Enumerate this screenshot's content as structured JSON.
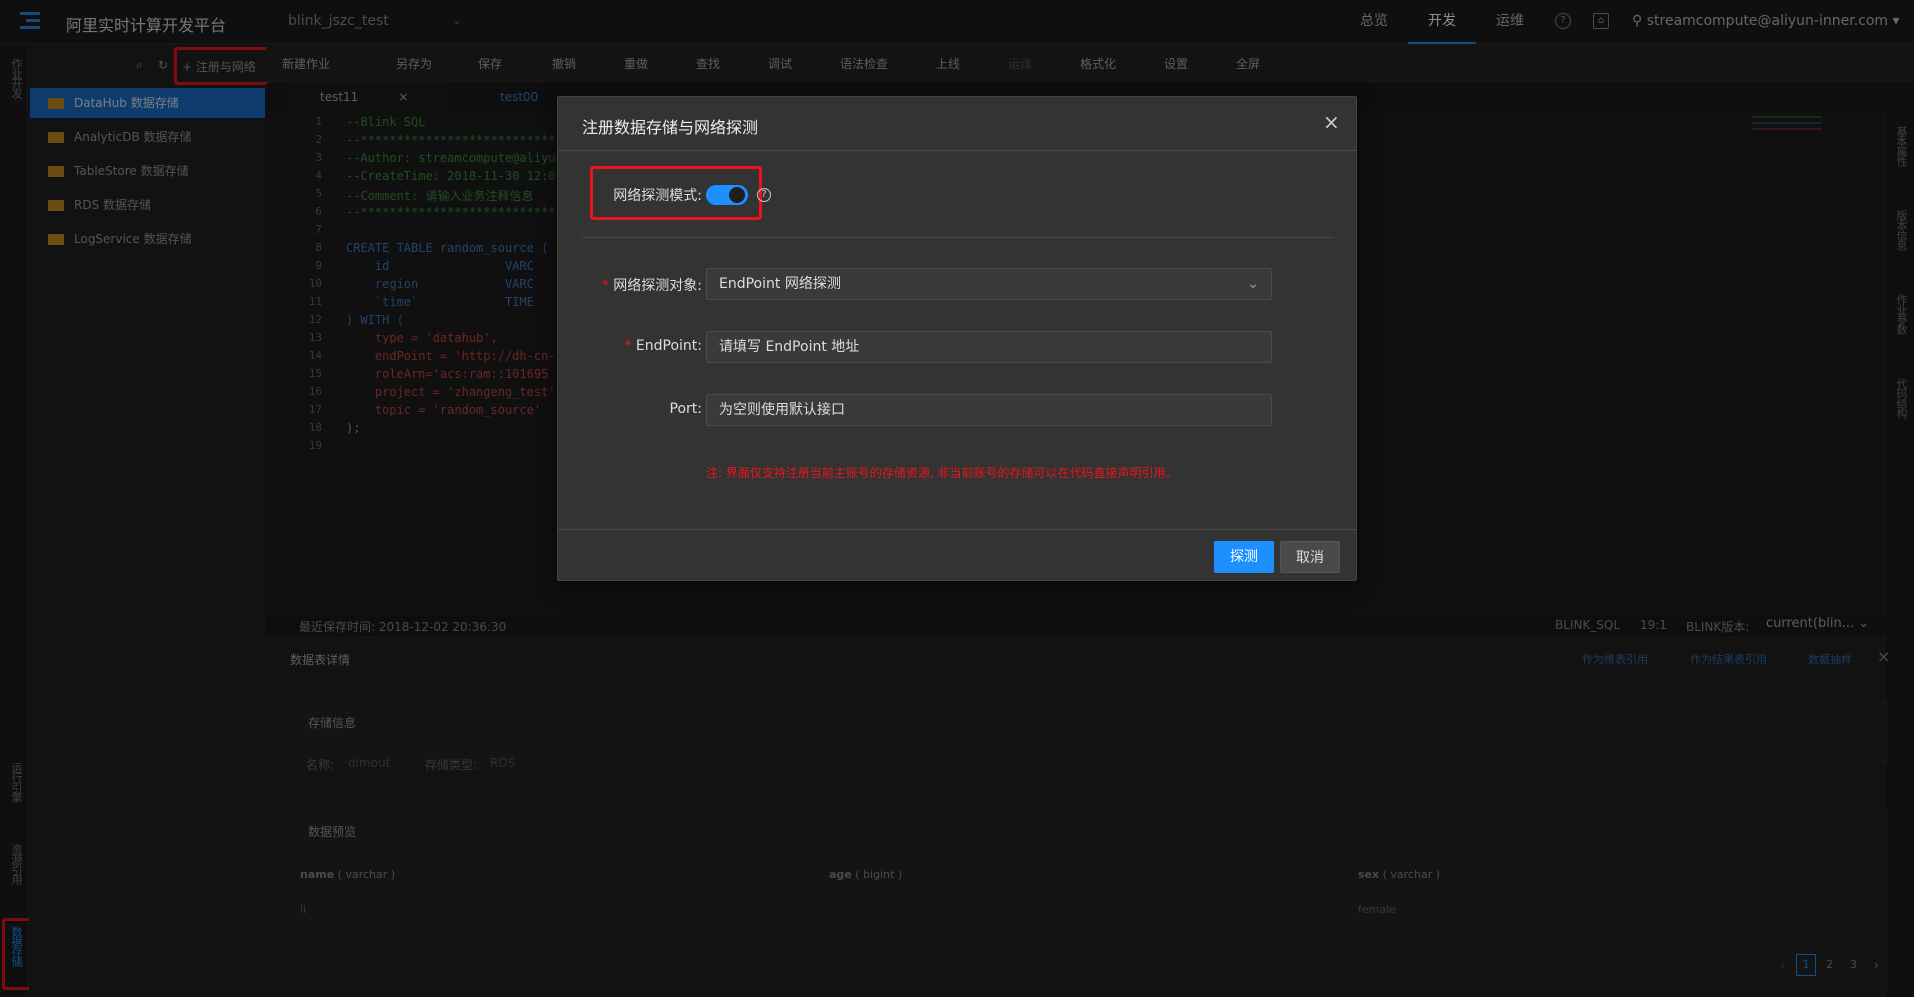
{
  "app": {
    "title": "阿里实时计算开发平台",
    "project": "blink_jszc_test"
  },
  "nav": {
    "items": [
      "总览",
      "开发",
      "运维"
    ],
    "active": "开发",
    "user": "streamcompute@aliyun-inner.com"
  },
  "left_strip": {
    "items": [
      "作业开发",
      "运行引擎",
      "资源引用",
      "数据存储"
    ]
  },
  "sidebar": {
    "register_label": "+ 注册与网络",
    "items": [
      "DataHub 数据存储",
      "AnalyticDB 数据存储",
      "TableStore 数据存储",
      "RDS 数据存储",
      "LogService 数据存储"
    ]
  },
  "toolbar": {
    "items": [
      "新建作业",
      "另存为",
      "保存",
      "撤销",
      "重做",
      "查找",
      "调试",
      "语法检查",
      "上线",
      "运维",
      "格式化",
      "设置",
      "全屏"
    ]
  },
  "tabs": [
    "test11",
    "test00"
  ],
  "editor": {
    "line_numbers": [
      "1",
      "2",
      "3",
      "4",
      "5",
      "6",
      "7",
      "8",
      "9",
      "10",
      "11",
      "12",
      "13",
      "14",
      "15",
      "16",
      "17",
      "18",
      "19"
    ],
    "lines": [
      "--Blink SQL",
      "--********************************",
      "--Author: streamcompute@aliyun",
      "--CreateTime: 2018-11-30 12:0",
      "--Comment: 请输入业务注释信息",
      "--********************************",
      "",
      "CREATE TABLE random_source (",
      "    id                VARC",
      "    region            VARC",
      "    `time`            TIME",
      ") WITH (",
      "    type = 'datahub',",
      "    endPoint = 'http://dh-cn-",
      "    roleArn='acs:ram::101695",
      "    project = 'zhangeng_test'",
      "    topic = 'random_source'",
      ");",
      ""
    ]
  },
  "right_strip": [
    "基本属性",
    "版本信息",
    "作业参数",
    "代码结构"
  ],
  "status": {
    "saved": "最近保存时间:  2018-12-02 20:36:30",
    "lang": "BLINK_SQL",
    "pos": "19:1",
    "version_label": "BLINK版本:",
    "version": "current(blin..."
  },
  "panel": {
    "title": "数据表详情",
    "actions": [
      "作为维表引用",
      "作为结果表引用",
      "数据抽样"
    ],
    "storage_title": "存储信息",
    "name_label": "名称:",
    "name_value": "dimout",
    "type_label": "存储类型:",
    "type_value": "RDS",
    "preview_title": "数据预览",
    "columns": [
      {
        "name": "name",
        "type": "( varchar )"
      },
      {
        "name": "age",
        "type": "( bigint )"
      },
      {
        "name": "sex",
        "type": "( varchar )"
      }
    ],
    "row": [
      "li",
      "",
      "female"
    ],
    "pages": [
      "1",
      "2",
      "3"
    ]
  },
  "modal": {
    "title": "注册数据存储与网络探测",
    "mode_label": "网络探测模式:",
    "mode_on": true,
    "target_label": "网络探测对象:",
    "target_value": "EndPoint 网络探测",
    "endpoint_label": "EndPoint:",
    "endpoint_placeholder": "请填写 EndPoint 地址",
    "port_label": "Port:",
    "port_placeholder": "为空则使用默认接口",
    "note": "注: 界面仅支持注册当前主账号的存储资源, 非当前账号的存储可以在代码直接声明引用。",
    "ok": "探测",
    "cancel": "取消"
  }
}
